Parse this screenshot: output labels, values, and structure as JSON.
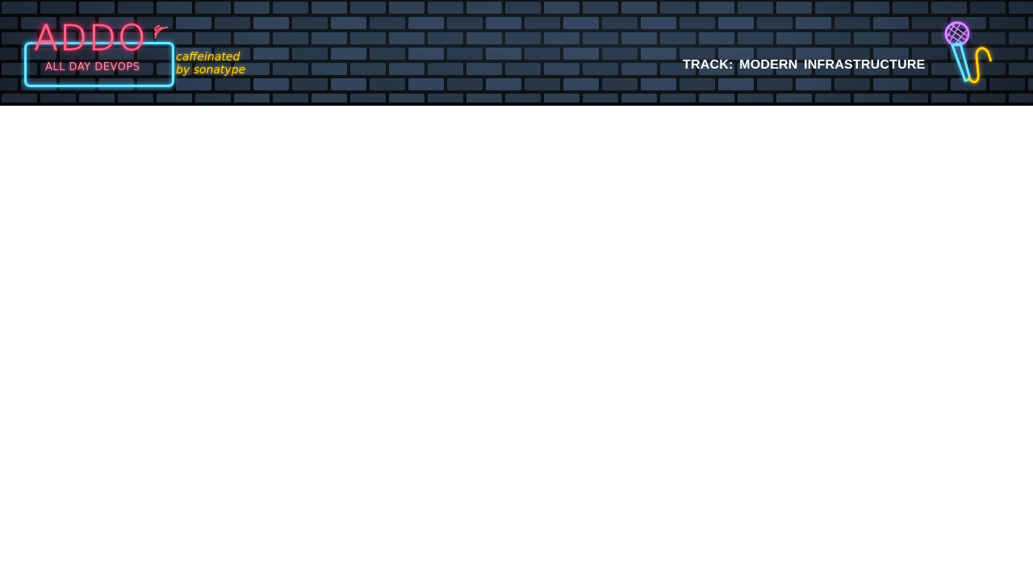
{
  "header": {
    "logo": {
      "wordmark": "ADDO",
      "subtitle": "ALL DAY DEVOPS",
      "tagline_line1": "caffeinated",
      "tagline_line2": "by sonatype"
    },
    "track_label": "TRACK:  MODERN  INFRASTRUCTURE",
    "icon": "microphone-icon"
  },
  "colors": {
    "brick": "#263444",
    "mortar": "#07090c",
    "neon_pink": "#ff4f78",
    "neon_cyan": "#6fe6ff",
    "neon_yellow": "#ffd21f",
    "neon_purple": "#c15cff",
    "track_text": "#ffffff",
    "content_background": "#ffffff"
  }
}
